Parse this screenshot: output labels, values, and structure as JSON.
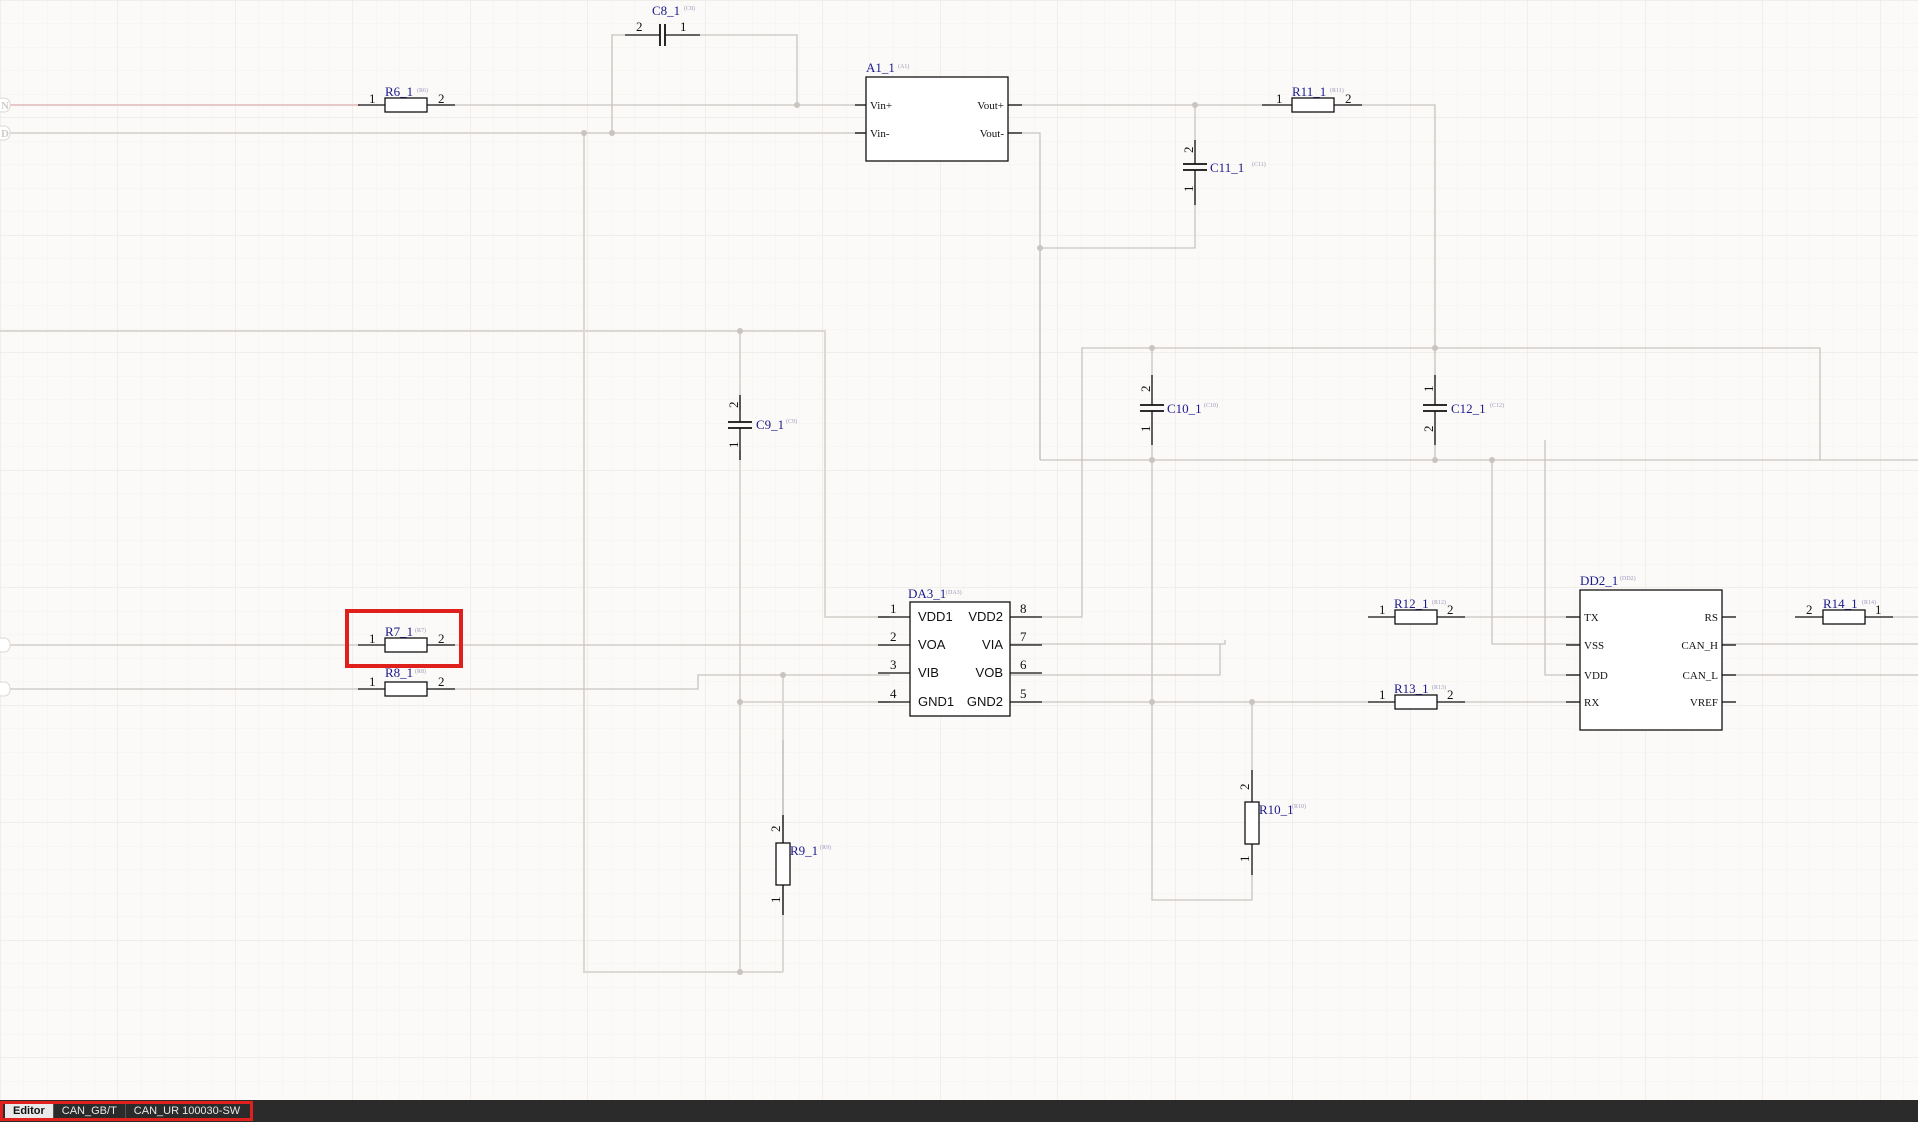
{
  "bottom_tabs": [
    {
      "label": "Editor",
      "active": true
    },
    {
      "label": "CAN_GB/T",
      "active": false
    },
    {
      "label": "CAN_UR 100030-SW",
      "active": false
    }
  ],
  "components": {
    "c8": {
      "designator": "C8_1",
      "ref": "(C8)",
      "pin_a": "2",
      "pin_b": "1"
    },
    "r6": {
      "designator": "R6_1",
      "ref": "(R6)",
      "pin_a": "1",
      "pin_b": "2"
    },
    "a1": {
      "designator": "A1_1",
      "ref": "(A1)",
      "pins": [
        "Vin+",
        "Vin-",
        "Vout+",
        "Vout-"
      ]
    },
    "r11": {
      "designator": "R11_1",
      "ref": "(R11)",
      "pin_a": "1",
      "pin_b": "2"
    },
    "c11": {
      "designator": "C11_1",
      "ref": "(C11)",
      "pin_a": "2",
      "pin_b": "1"
    },
    "c9": {
      "designator": "C9_1",
      "ref": "(C9)",
      "pin_a": "2",
      "pin_b": "1"
    },
    "c10": {
      "designator": "C10_1",
      "ref": "(C10)",
      "pin_a": "2",
      "pin_b": "1"
    },
    "c12": {
      "designator": "C12_1",
      "ref": "(C12)",
      "pin_a": "1",
      "pin_b": "2"
    },
    "r7": {
      "designator": "R7_1",
      "ref": "(R7)",
      "pin_a": "1",
      "pin_b": "2"
    },
    "r8": {
      "designator": "R8_1",
      "ref": "(R8)",
      "pin_a": "1",
      "pin_b": "2"
    },
    "da3": {
      "designator": "DA3_1",
      "ref": "(DA3)",
      "left": [
        {
          "num": "1",
          "name": "VDD1"
        },
        {
          "num": "2",
          "name": "VOA"
        },
        {
          "num": "3",
          "name": "VIB"
        },
        {
          "num": "4",
          "name": "GND1"
        }
      ],
      "right": [
        {
          "num": "8",
          "name": "VDD2"
        },
        {
          "num": "7",
          "name": "VIA"
        },
        {
          "num": "6",
          "name": "VOB"
        },
        {
          "num": "5",
          "name": "GND2"
        }
      ]
    },
    "r12": {
      "designator": "R12_1",
      "ref": "(R12)",
      "pin_a": "1",
      "pin_b": "2"
    },
    "r13": {
      "designator": "R13_1",
      "ref": "(R13)",
      "pin_a": "1",
      "pin_b": "2"
    },
    "r9": {
      "designator": "R9_1",
      "ref": "(R9)",
      "pin_a": "2",
      "pin_b": "1"
    },
    "r10": {
      "designator": "R10_1",
      "ref": "(R10)",
      "pin_a": "2",
      "pin_b": "1"
    },
    "dd2": {
      "designator": "DD2_1",
      "ref": "(DD2)",
      "left": [
        "TX",
        "VSS",
        "VDD",
        "RX"
      ],
      "right": [
        "RS",
        "CAN_H",
        "CAN_L",
        "VREF"
      ]
    },
    "r14": {
      "designator": "R14_1",
      "ref": "(R14)",
      "pin_a": "2",
      "pin_b": "1"
    }
  },
  "net_labels": {
    "top": "N",
    "second": "D"
  },
  "colors": {
    "highlight": "#e0201c",
    "wire": "#c8c4c0",
    "designator": "#1a1a8a",
    "grid": "#ece8e3"
  }
}
